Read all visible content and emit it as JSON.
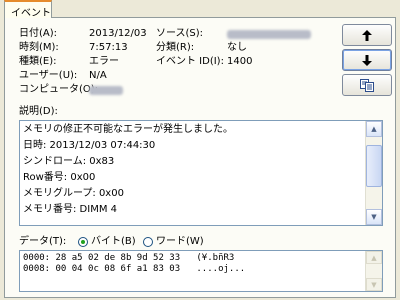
{
  "tab": {
    "label": "イベント"
  },
  "fields": {
    "date": {
      "label": "日付(A):",
      "value": "2013/12/03"
    },
    "time": {
      "label": "時刻(M):",
      "value": "7:57:13"
    },
    "type": {
      "label": "種類(E):",
      "value": "エラー"
    },
    "user": {
      "label": "ユーザー(U):",
      "value": "N/A"
    },
    "computer": {
      "label": "コンピュータ(O):"
    },
    "source": {
      "label": "ソース(S):"
    },
    "category": {
      "label": "分類(R):",
      "value": "なし"
    },
    "event_id": {
      "label": "イベント ID(I):",
      "value": "1400"
    }
  },
  "nav": {
    "up_icon": "arrow-up",
    "down_icon": "arrow-down",
    "copy_icon": "copy-documents"
  },
  "description": {
    "label": "説明(D):",
    "lines": [
      "メモリの修正不可能なエラーが発生しました。",
      " 日時: 2013/12/03 07:44:30",
      "シンドローム: 0x83",
      "Row番号: 0x00",
      "メモリグループ: 0x00",
      "メモリ番号: DIMM 4"
    ]
  },
  "data_section": {
    "label": "データ(T):",
    "byte_option": "バイト(B)",
    "word_option": "ワード(W)",
    "selected": "byte",
    "lines": [
      "0000: 28 a5 02 de 8b 9d 52 33   (¥.bñR3",
      "0008: 00 04 0c 08 6f a1 83 03   ....oj..."
    ]
  },
  "colors": {
    "window_bg": "#ece9d8",
    "panel_bg": "#fcfcf6",
    "tab_accent": "#e68b2c",
    "field_border": "#7f9db9"
  }
}
